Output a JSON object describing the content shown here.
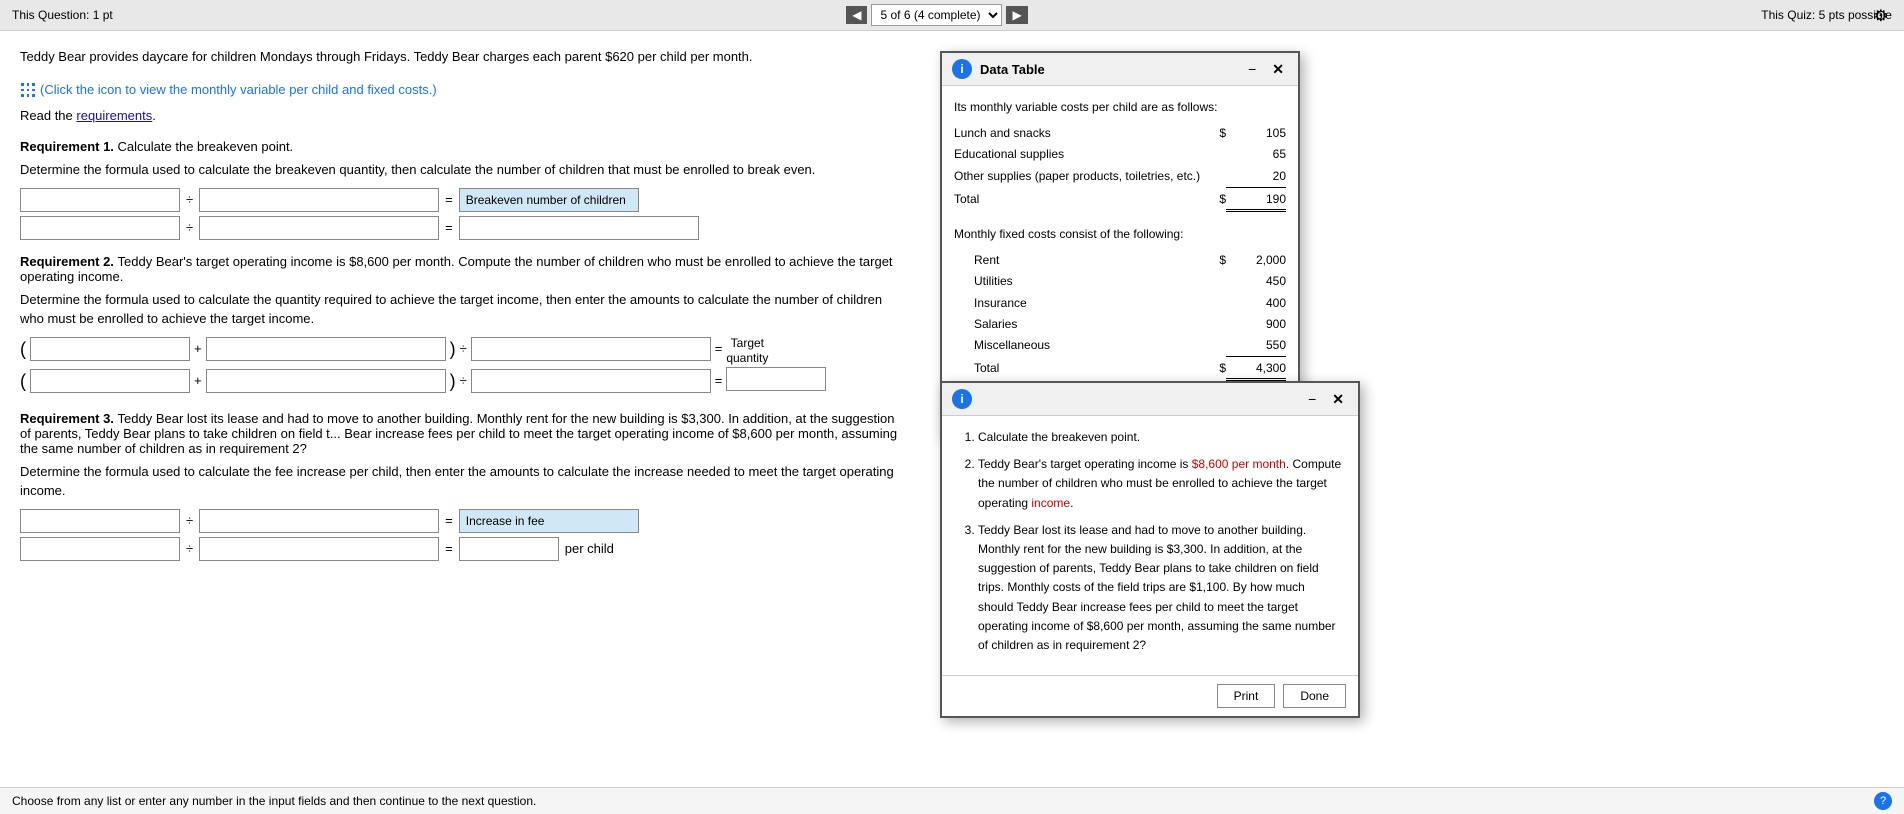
{
  "topbar": {
    "question_label": "This Question: 1 pt",
    "nav_status": "5 of 6 (4 complete)",
    "quiz_label": "This Quiz: 5 pts possible"
  },
  "question": {
    "intro": "Teddy Bear provides daycare for children Mondays through Fridays. Teddy Bear charges each parent $620 per child per month.",
    "icon_link_text": "(Click the icon to view the monthly variable per child and fixed costs.)",
    "read_text": "Read the",
    "requirements_link": "requirements",
    "req1_title": "Requirement 1.",
    "req1_text": "Calculate the breakeven point.",
    "req1_desc": "Determine the formula used to calculate the breakeven quantity, then calculate the number of children that must be enrolled to break even.",
    "req1_result_label": "Breakeven number of children",
    "req2_title": "Requirement 2.",
    "req2_text": "Teddy Bear's target operating income is $8,600 per month. Compute the number of children who must be enrolled to achieve the target operating income.",
    "req2_desc": "Determine the formula used to calculate the quantity required to achieve the target income, then enter the amounts to calculate the number of children who must be enrolled to achieve the target income.",
    "req2_target_label": "Target\nquantity",
    "req3_title": "Requirement 3.",
    "req3_text": "Teddy Bear lost its lease and had to move to another building. Monthly rent for the new building is $3,300. In addition, at the suggestion of parents, Teddy Bear plans to take children on field trips are $1,100. By how much should Teddy Bear increase fees per child to meet the target operating income of $8,600 per month, assuming the same number of children as in requirement 2?",
    "req3_desc": "Determine the formula used to calculate the fee increase per child, then enter the amounts to calculate the increase needed to meet the target operating income.",
    "req3_result_label1": "Increase in fee",
    "req3_result_label2": "per child",
    "bottom_note": "Choose from any list or enter any number in the input fields and then continue to the next question."
  },
  "data_table_modal": {
    "title": "Data Table",
    "variable_costs_title": "Its monthly variable costs per child are as follows:",
    "variable_costs": [
      {
        "label": "Lunch and snacks",
        "symbol": "$",
        "value": "105"
      },
      {
        "label": "Educational supplies",
        "symbol": "",
        "value": "65"
      },
      {
        "label": "Other supplies (paper products, toiletries, etc.)",
        "symbol": "",
        "value": "20"
      },
      {
        "label": "Total",
        "symbol": "$",
        "value": "190"
      }
    ],
    "fixed_costs_title": "Monthly fixed costs consist of the following:",
    "fixed_costs": [
      {
        "label": "Rent",
        "symbol": "$",
        "value": "2,000"
      },
      {
        "label": "Utilities",
        "symbol": "",
        "value": "450"
      },
      {
        "label": "Insurance",
        "symbol": "",
        "value": "400"
      },
      {
        "label": "Salaries",
        "symbol": "",
        "value": "900"
      },
      {
        "label": "Miscellaneous",
        "symbol": "",
        "value": "550"
      },
      {
        "label": "Total",
        "symbol": "$",
        "value": "4,300"
      }
    ],
    "print_label": "Print",
    "done_label": "Done"
  },
  "requirements_modal": {
    "req1": "Calculate the breakeven point.",
    "req2": "Teddy Bear's target operating income is $8,600 per month. Compute the number of children who must be enrolled to achieve the target operating income.",
    "req3": "Teddy Bear lost its lease and had to move to another building. Monthly rent for the new building is $3,300. In addition, at the suggestion of parents, Teddy Bear plans to take children on field trips. Monthly costs of the field trips are $1,100. By how much should Teddy Bear increase fees per child to meet the target operating income of $8,600 per month, assuming the same number of children as in requirement 2?",
    "print_label": "Print",
    "done_label": "Done"
  }
}
